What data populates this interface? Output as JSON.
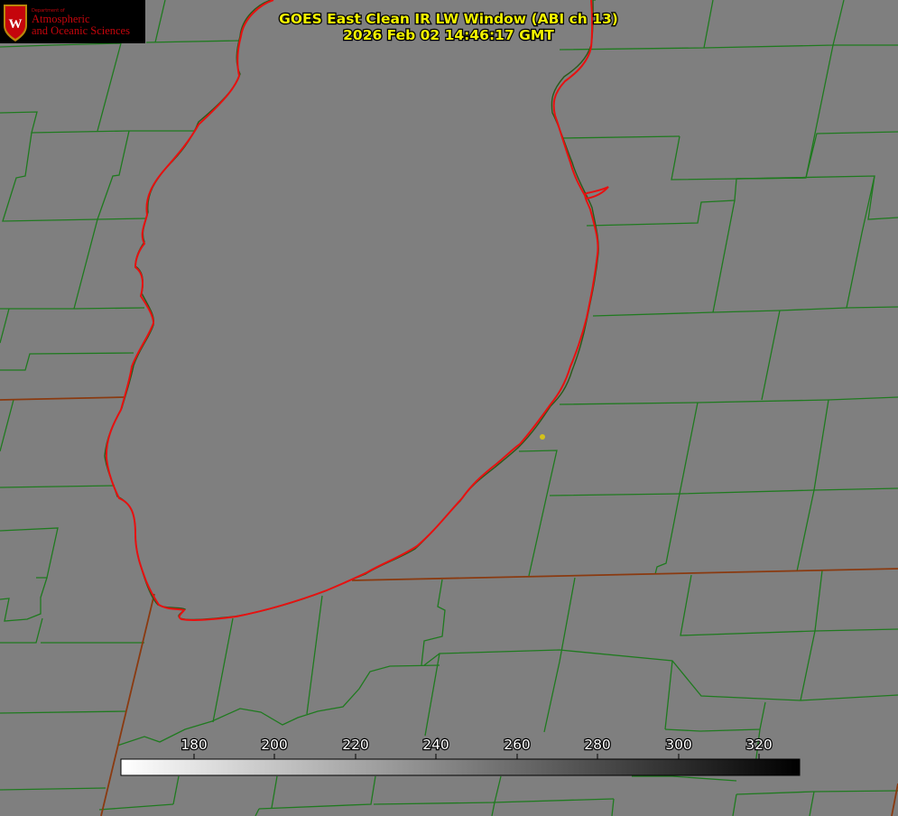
{
  "logo": {
    "dept": "Department of",
    "name_line1": "Atmospheric",
    "name_line2": "and Oceanic Sciences",
    "crest_letter": "W",
    "crest_icon": "uw-crest-icon"
  },
  "title": {
    "line1": "GOES East Clean IR LW Window (ABI ch 13)",
    "line2": "2026 Feb 02 14:46:17 GMT"
  },
  "colorbar": {
    "ticks": [
      "180",
      "200",
      "220",
      "240",
      "260",
      "280",
      "300",
      "320"
    ],
    "gradient_from": "#ffffff",
    "gradient_to": "#000000"
  },
  "colors": {
    "background": "#7f7f7f",
    "county_lines": "#1f7a1f",
    "state_lines": "#8a3a10",
    "lake_outline": "#e81010",
    "marker": "#d4c21a",
    "title_text": "#f2f200"
  }
}
